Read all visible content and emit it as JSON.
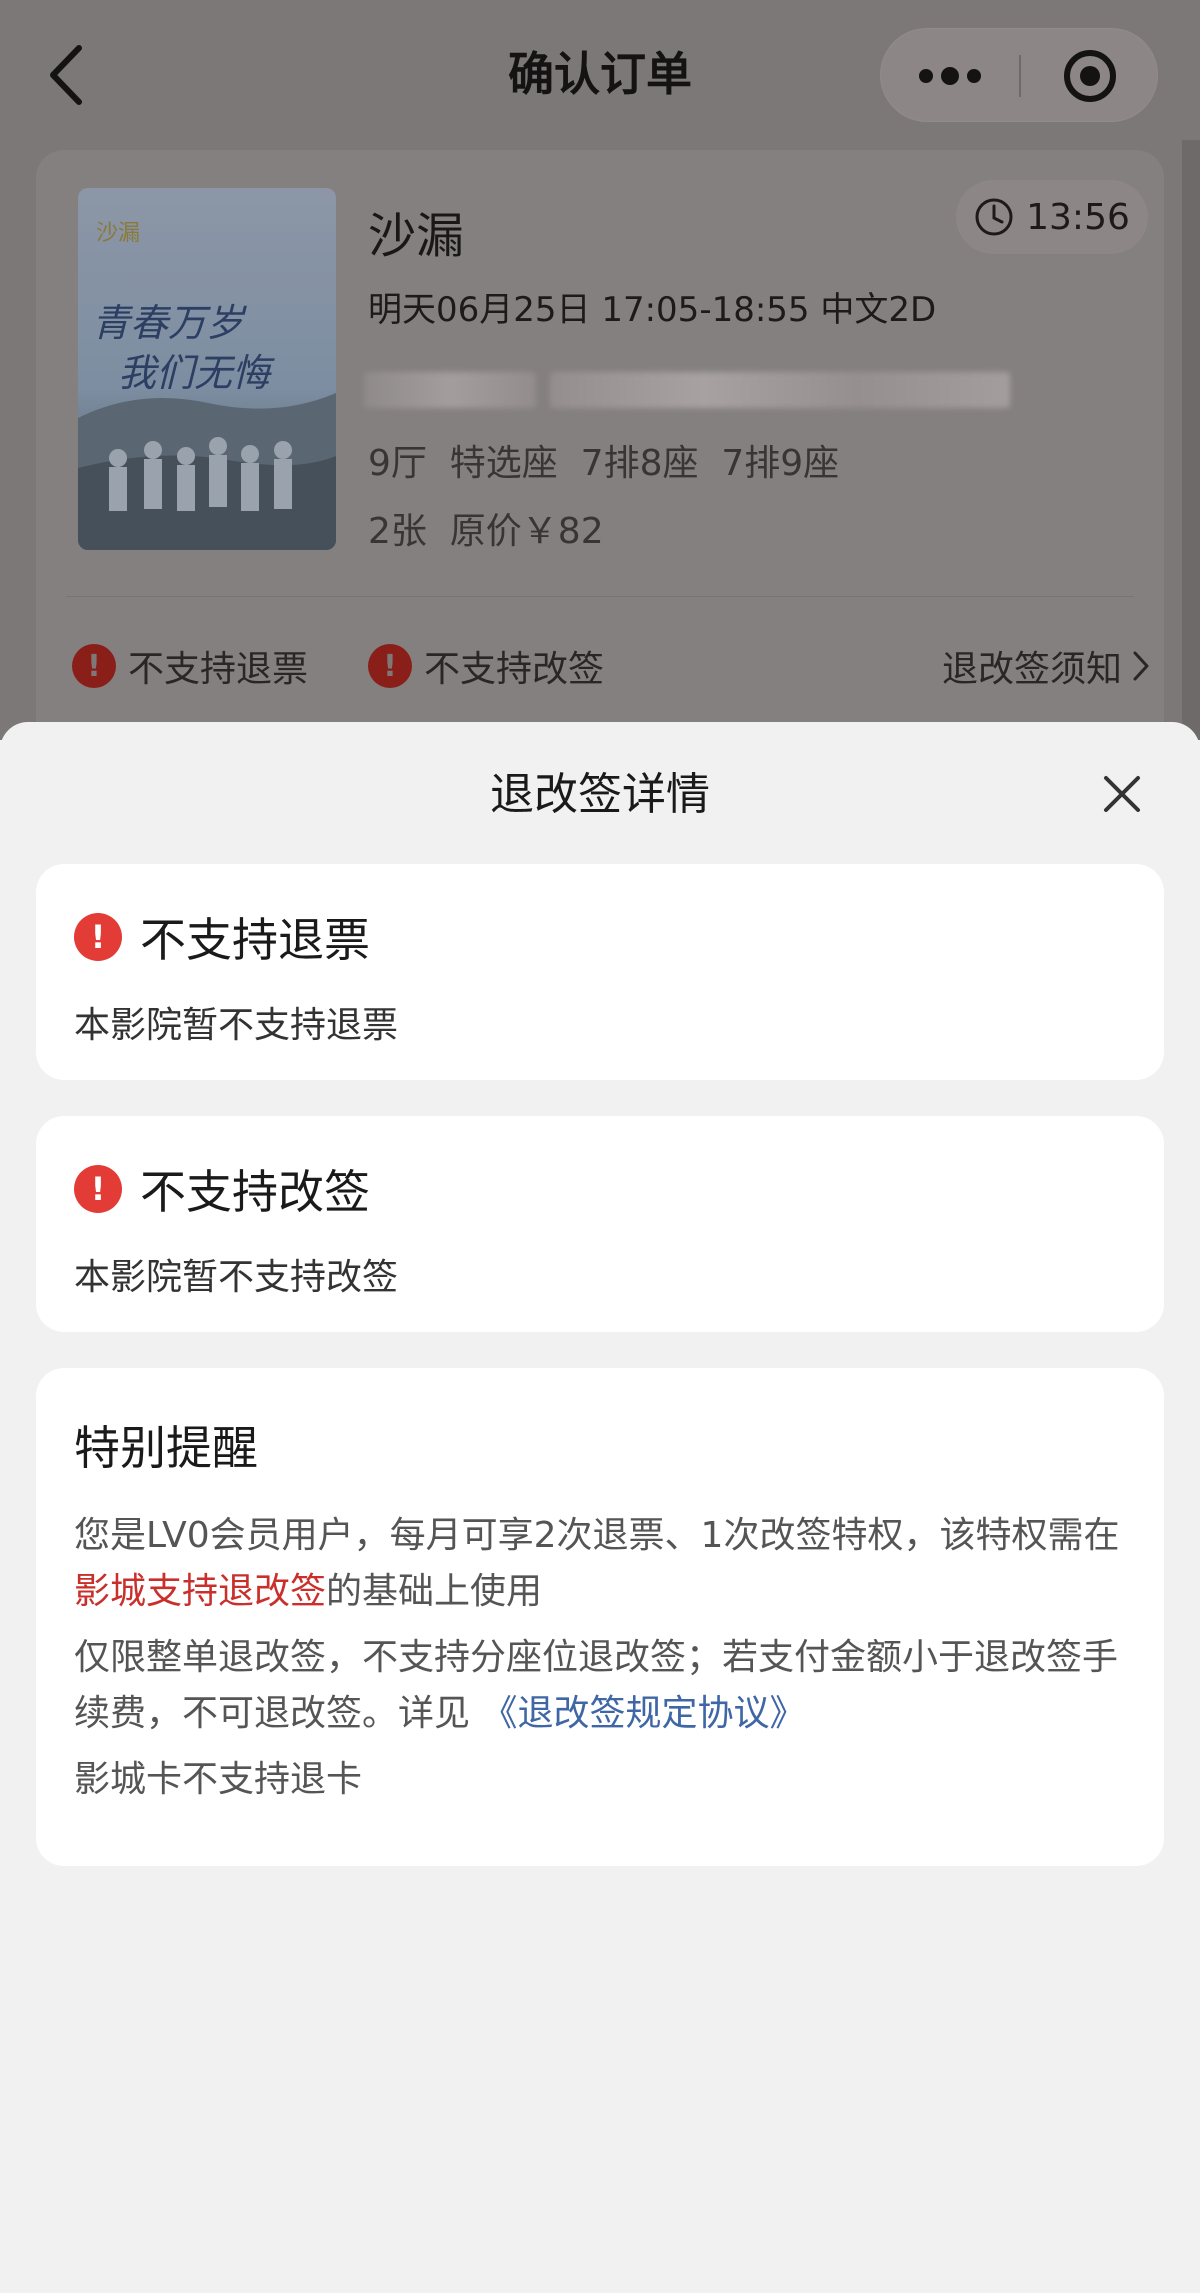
{
  "nav": {
    "title": "确认订单",
    "back_icon": "chevron-left-icon",
    "more_icon": "more-dots-icon",
    "target_icon": "target-icon"
  },
  "order": {
    "movie_title": "沙漏",
    "countdown": "13:56",
    "show_info": "明天06月25日 17:05-18:55 中文2D",
    "seat_info": "9厅  特选座  7排8座  7排9座",
    "price_info": "2张  原价￥82",
    "poster_text_1": "青春万岁",
    "poster_text_2": "我们无悔",
    "no_refund": "不支持退票",
    "no_change": "不支持改签",
    "policy_link": "退改签须知"
  },
  "sheet": {
    "title": "退改签详情",
    "refund": {
      "title": "不支持退票",
      "desc": "本影院暂不支持退票"
    },
    "change": {
      "title": "不支持改签",
      "desc": "本影院暂不支持改签"
    },
    "reminder": {
      "title": "特别提醒",
      "p1_before": "您是LV0会员用户，每月可享2次退票、1次改签特权，该特权需在",
      "p1_highlight": "影城支持退改签",
      "p1_after": "的基础上使用",
      "p2_before": "仅限整单退改签，不支持分座位退改签；若支付金额小于退改签手续费，不可退改签。详见 ",
      "p2_link": "《退改签规定协议》",
      "p3": "影城卡不支持退卡"
    }
  },
  "colors": {
    "warning_red": "#e33b36",
    "highlight_red": "#c9302c",
    "link_blue": "#3f66a5"
  }
}
